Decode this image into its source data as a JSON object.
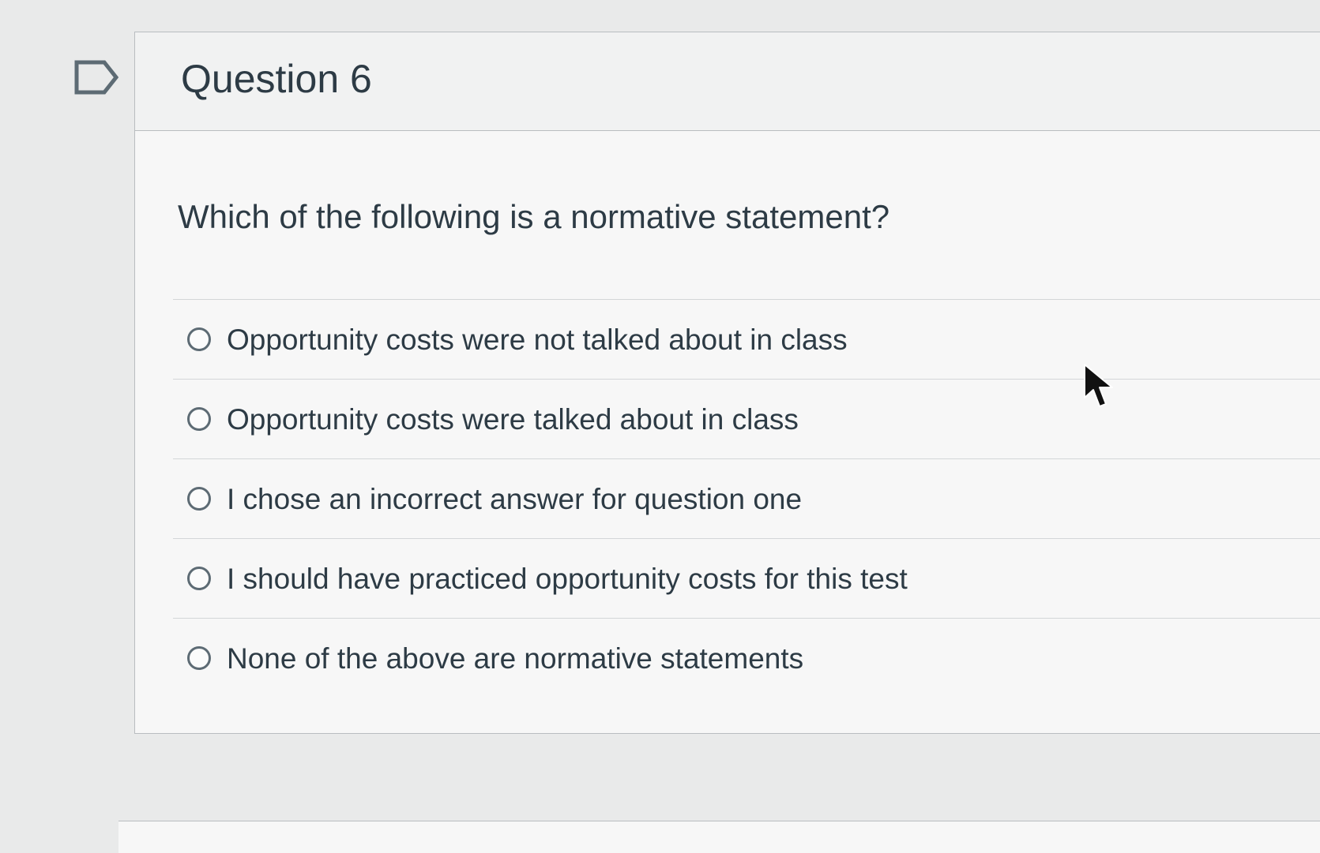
{
  "question": {
    "title": "Question 6",
    "text": "Which of the following is a normative statement?",
    "answers": [
      {
        "label": "Opportunity costs were not talked about in class"
      },
      {
        "label": "Opportunity costs were talked about in class"
      },
      {
        "label": "I chose an incorrect answer for question one"
      },
      {
        "label": "I should have practiced opportunity costs for this test"
      },
      {
        "label": "None of the above are normative statements"
      }
    ]
  },
  "icons": {
    "flag": "flag-outline-icon",
    "cursor": "mouse-pointer-icon"
  },
  "colors": {
    "text": "#2d3b45",
    "radio_border": "#5d6b74",
    "card_background": "#f7f7f7",
    "page_background": "#e9eaea"
  }
}
